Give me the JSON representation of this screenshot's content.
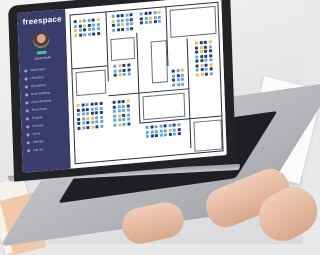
{
  "app": {
    "brand": "freespace",
    "user_name": "Sarah Smith",
    "status_color": "#4cc38a",
    "accent": "#3a3d6b"
  },
  "sidebar": {
    "items": [
      {
        "label": "Dashboard",
        "icon": "grid-icon"
      },
      {
        "label": "Utilisation",
        "icon": "chart-icon"
      },
      {
        "label": "Occupancy",
        "icon": "people-icon"
      },
      {
        "label": "Desk Booking",
        "icon": "desk-icon"
      },
      {
        "label": "Room Booking",
        "icon": "door-icon"
      },
      {
        "label": "Floor Plans",
        "icon": "map-icon"
      },
      {
        "label": "Reports",
        "icon": "document-icon"
      },
      {
        "label": "Sensors",
        "icon": "sensor-icon"
      },
      {
        "label": "Alerts",
        "icon": "bell-icon"
      },
      {
        "label": "Settings",
        "icon": "gear-icon"
      },
      {
        "label": "Log out",
        "icon": "logout-icon"
      }
    ]
  },
  "floorplan": {
    "desk_colors": {
      "available": "#5fa8e3",
      "occupied": "#1f3a8a",
      "reserved": "#f2c230"
    }
  }
}
